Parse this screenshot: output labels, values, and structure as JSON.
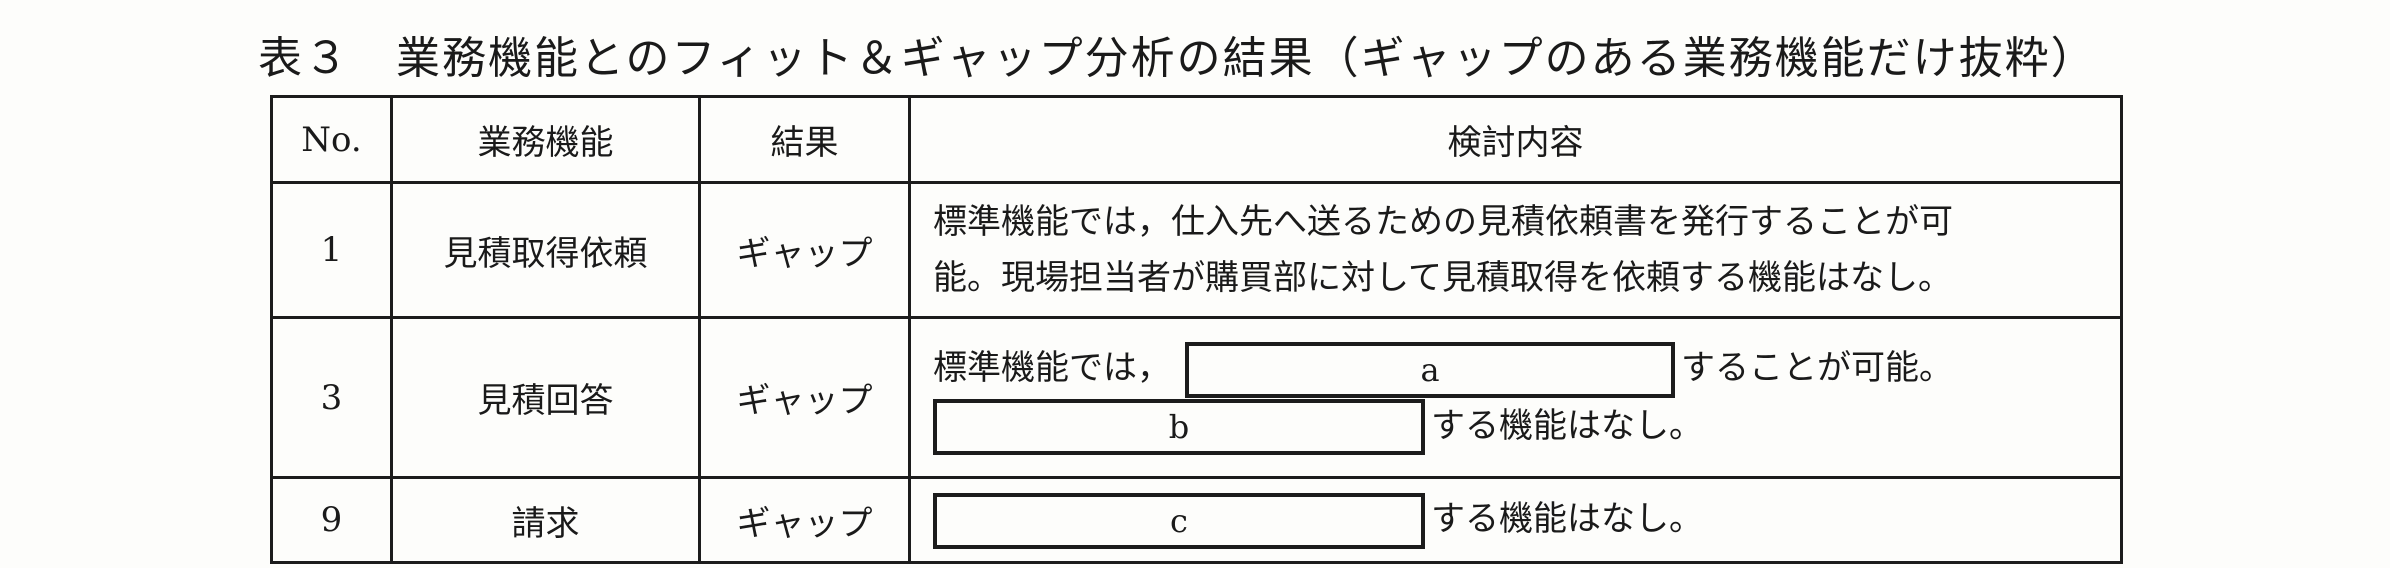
{
  "title": "表３　業務機能とのフィット＆ギャップ分析の結果（ギャップのある業務機能だけ抜粋）",
  "table": {
    "headers": {
      "no": "No.",
      "function": "業務機能",
      "result": "結果",
      "detail": "検討内容"
    },
    "rows": [
      {
        "no": "1",
        "function": "見積取得依頼",
        "result": "ギャップ",
        "detail_line1": "標準機能では，仕入先へ送るための見積依頼書を発行することが可",
        "detail_line2": "能。現場担当者が購買部に対して見積取得を依頼する機能はなし。"
      },
      {
        "no": "3",
        "function": "見積回答",
        "result": "ギャップ",
        "detail_prefix": "標準機能では，",
        "blank_a": "a",
        "detail_suffix1": "することが可能。",
        "blank_b": "b",
        "detail_suffix2": "する機能はなし。"
      },
      {
        "no": "9",
        "function": "請求",
        "result": "ギャップ",
        "blank_c": "c",
        "detail_suffix": "する機能はなし。"
      }
    ]
  }
}
